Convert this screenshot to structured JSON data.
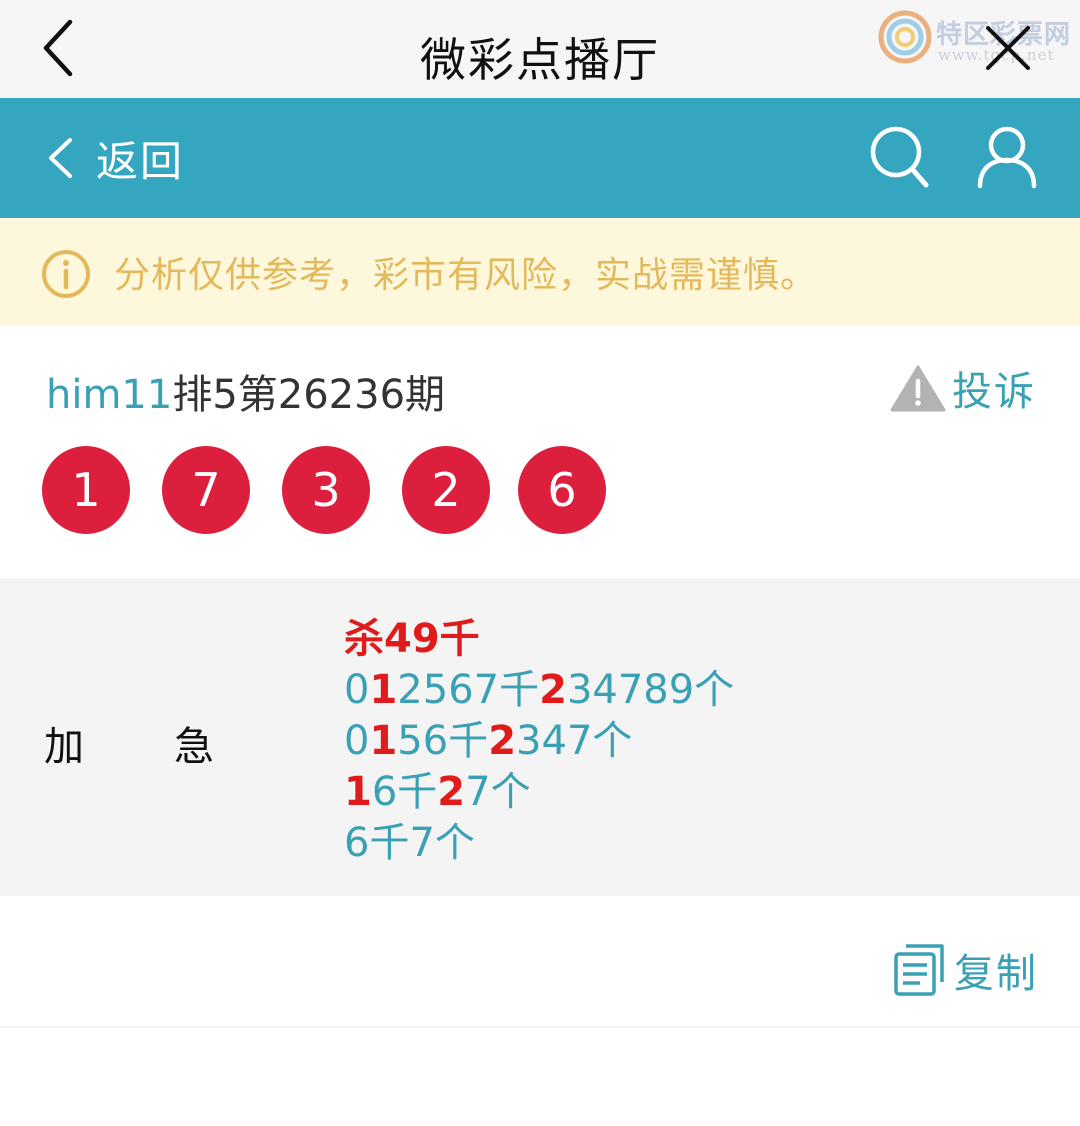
{
  "window": {
    "title": "微彩点播厅"
  },
  "watermark": {
    "brand": "特区彩票网",
    "url": "www.tqcp.net"
  },
  "nav": {
    "back_label": "返回"
  },
  "notice": {
    "text": "分析仅供参考，彩市有风险，实战需谨慎。"
  },
  "issue": {
    "user": "him11",
    "title": "排5第26236期",
    "complain_label": "投诉"
  },
  "balls": [
    "1",
    "7",
    "3",
    "2",
    "6"
  ],
  "prediction": {
    "label_a": "加",
    "label_b": "急",
    "lines": [
      [
        {
          "t": "杀49千",
          "red": true
        }
      ],
      [
        {
          "t": "0",
          "red": false
        },
        {
          "t": "1",
          "red": true
        },
        {
          "t": "2567千",
          "red": false
        },
        {
          "t": "2",
          "red": true
        },
        {
          "t": "34789个",
          "red": false
        }
      ],
      [
        {
          "t": "0",
          "red": false
        },
        {
          "t": "1",
          "red": true
        },
        {
          "t": "56千",
          "red": false
        },
        {
          "t": "2",
          "red": true
        },
        {
          "t": "347个",
          "red": false
        }
      ],
      [
        {
          "t": "1",
          "red": true
        },
        {
          "t": "6千",
          "red": false
        },
        {
          "t": "2",
          "red": true
        },
        {
          "t": "7个",
          "red": false
        }
      ],
      [
        {
          "t": "6千7个",
          "red": false
        }
      ]
    ]
  },
  "copy": {
    "label": "复制"
  },
  "colors": {
    "accent": "#35a6bf",
    "ball": "#db1f3d",
    "highlight": "#e01b1b",
    "notice_text": "#e3b95b"
  },
  "icons": [
    "back-icon",
    "close-icon",
    "chevron-left-icon",
    "search-icon",
    "user-icon",
    "info-icon",
    "warning-icon",
    "copy-icon"
  ]
}
